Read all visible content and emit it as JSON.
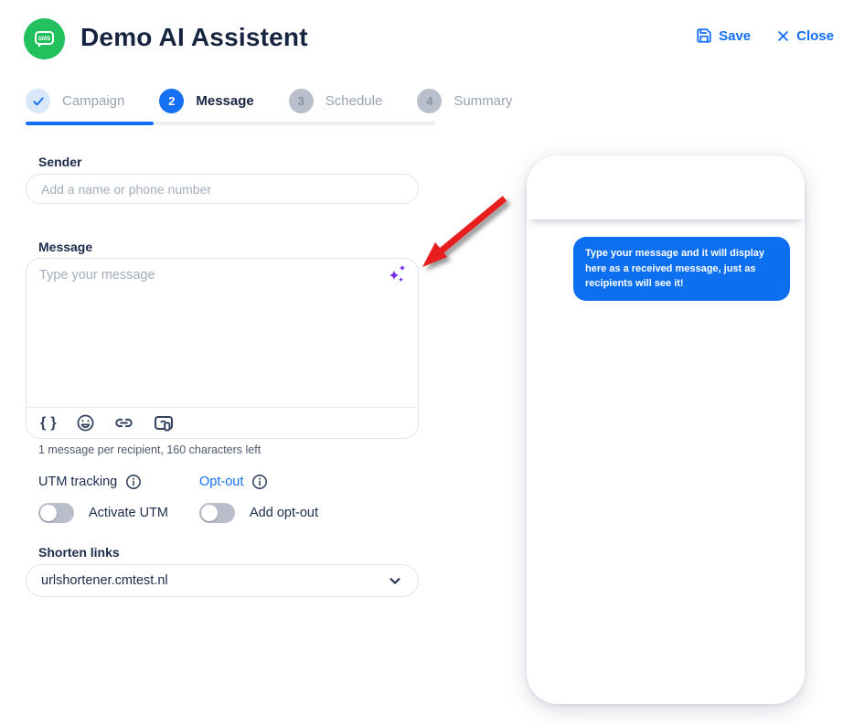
{
  "header": {
    "app_icon_label": "SMS",
    "title": "Demo AI Assistent",
    "save_label": "Save",
    "close_label": "Close"
  },
  "tabs": [
    {
      "label": "Campaign",
      "indicator": "check",
      "state": "completed"
    },
    {
      "label": "Message",
      "indicator": "2",
      "state": "active"
    },
    {
      "label": "Schedule",
      "indicator": "3",
      "state": "upcoming"
    },
    {
      "label": "Summary",
      "indicator": "4",
      "state": "upcoming"
    }
  ],
  "form": {
    "sender": {
      "label": "Sender",
      "placeholder": "Add a name or phone number",
      "value": ""
    },
    "message": {
      "label": "Message",
      "placeholder": "Type your message",
      "value": "",
      "toolbar_icons": [
        "personalization-braces",
        "emoji",
        "link",
        "landing-page"
      ],
      "ai_icon": "sparkles",
      "counter": "1 message per recipient, 160 characters left"
    },
    "utm": {
      "label": "UTM tracking",
      "toggle_label": "Activate UTM",
      "active": false
    },
    "optout": {
      "label": "Opt-out",
      "toggle_label": "Add opt-out",
      "active": false
    },
    "shorten": {
      "label": "Shorten links",
      "selected": "urlshortener.cmtest.nl"
    }
  },
  "preview": {
    "bubble_text": "Type your message and it will display here as a received message, just as recipients will see it!"
  },
  "colors": {
    "accent_blue": "#146ef5",
    "tab_blue": "#156ff2",
    "bubble_blue": "#0c6ff0",
    "brand_green": "#23c05e",
    "sparkle_purple": "#7a2cf0",
    "arrow_red": "#e81d1d",
    "text_dark": "#172440",
    "text_muted": "#9aa3b2"
  }
}
